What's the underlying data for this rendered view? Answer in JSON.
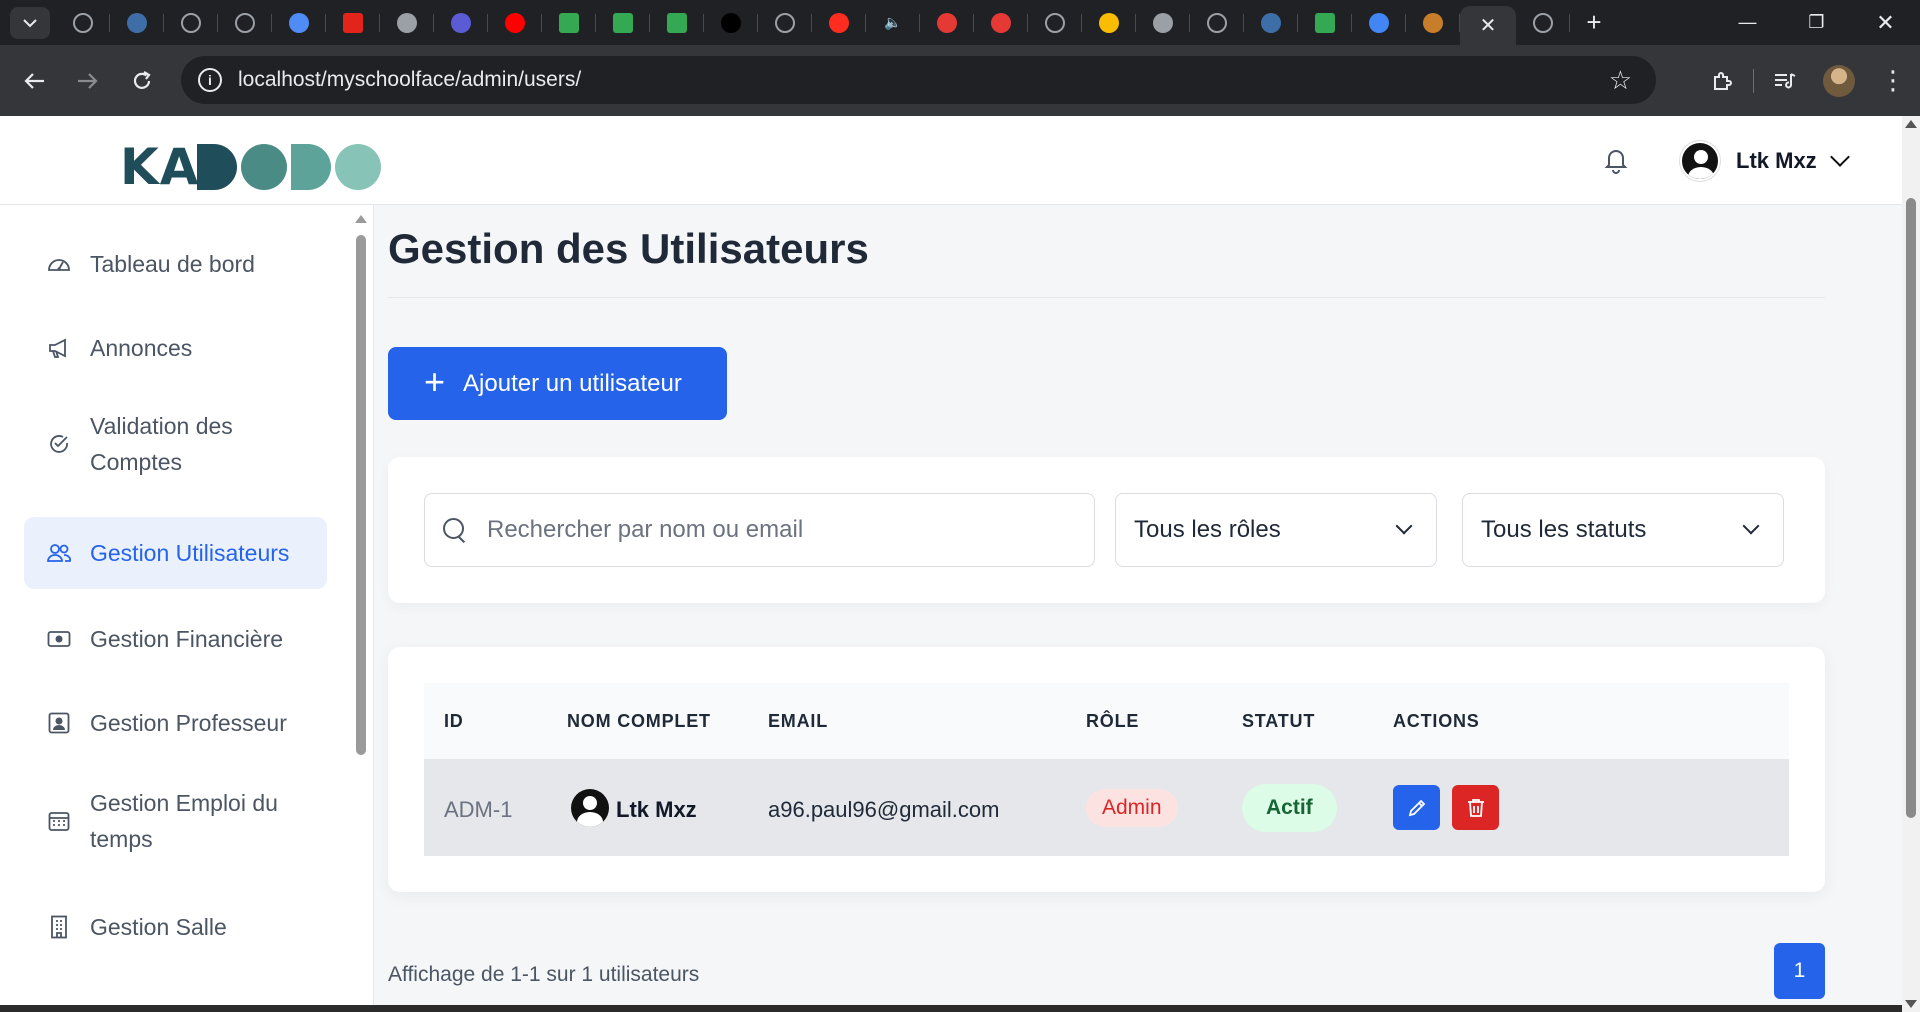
{
  "browser": {
    "url": "localhost/myschoolface/admin/users/",
    "tabs": [
      {
        "icon": "globe-icon",
        "color": "#5f6368"
      },
      {
        "icon": "image-icon",
        "color": "#3d6ea8"
      },
      {
        "icon": "globe-icon",
        "color": "#5f6368"
      },
      {
        "icon": "globe-icon",
        "color": "#5f6368"
      },
      {
        "icon": "gemini-icon",
        "color": "#4f8cf7"
      },
      {
        "icon": "adobe-icon",
        "color": "#e3241b"
      },
      {
        "icon": "chrome-icon",
        "color": "#9aa0a6"
      },
      {
        "icon": "app-icon",
        "color": "#5b5bd6"
      },
      {
        "icon": "youtube-icon",
        "color": "#ff0000"
      },
      {
        "icon": "drive-icon",
        "color": "#34a853"
      },
      {
        "icon": "drive-icon",
        "color": "#34a853"
      },
      {
        "icon": "drive-icon",
        "color": "#34a853"
      },
      {
        "icon": "tiktok-icon",
        "color": "#000000"
      },
      {
        "icon": "globe-icon",
        "color": "#5f6368"
      },
      {
        "icon": "laravel-icon",
        "color": "#ff2d20"
      },
      {
        "icon": "speaker-icon",
        "color": "#e8eaed"
      },
      {
        "icon": "runner-icon",
        "color": "#e53935"
      },
      {
        "icon": "runner-icon",
        "color": "#e53935"
      },
      {
        "icon": "globe-icon",
        "color": "#5f6368"
      },
      {
        "icon": "pinwheel-icon",
        "color": "#fbbc04"
      },
      {
        "icon": "chrome-icon",
        "color": "#9aa0a6"
      },
      {
        "icon": "globe-icon",
        "color": "#5f6368"
      },
      {
        "icon": "image-icon",
        "color": "#3d6ea8"
      },
      {
        "icon": "drive-icon",
        "color": "#34a853"
      },
      {
        "icon": "google-icon",
        "color": "#4285f4"
      },
      {
        "icon": "maiden-icon",
        "color": "#c77d2a"
      }
    ],
    "active_tab_close": "✕",
    "after_tabs": [
      {
        "icon": "globe-icon",
        "color": "#5f6368"
      }
    ],
    "new_tab": "+",
    "window": {
      "minimize": "—",
      "restore": "❐",
      "close": "✕"
    }
  },
  "header": {
    "logo": {
      "text": "KA",
      "dots": [
        "#1f4e5a",
        "#4a8b86",
        "#5da39a",
        "#87c4b7"
      ]
    },
    "user_name": "Ltk Mxz"
  },
  "sidebar": {
    "items": [
      {
        "label": "Tableau de bord",
        "icon": "dashboard-icon",
        "active": false
      },
      {
        "label": "Annonces",
        "icon": "megaphone-icon",
        "active": false
      },
      {
        "label": "Validation des Comptes",
        "icon": "check-circle-icon",
        "active": false
      },
      {
        "label": "Gestion Utilisateurs",
        "icon": "users-icon",
        "active": true
      },
      {
        "label": "Gestion Financière",
        "icon": "money-icon",
        "active": false
      },
      {
        "label": "Gestion Professeur",
        "icon": "id-card-icon",
        "active": false
      },
      {
        "label": "Gestion Emploi du temps",
        "icon": "calendar-icon",
        "active": false
      },
      {
        "label": "Gestion Salle",
        "icon": "building-icon",
        "active": false
      }
    ]
  },
  "main": {
    "title": "Gestion des Utilisateurs",
    "add_button": "Ajouter un utilisateur",
    "search_placeholder": "Rechercher par nom ou email",
    "role_filter": "Tous les rôles",
    "status_filter": "Tous les statuts",
    "table": {
      "columns": [
        "ID",
        "NOM COMPLET",
        "EMAIL",
        "RÔLE",
        "STATUT",
        "ACTIONS"
      ],
      "rows": [
        {
          "id": "ADM-1",
          "name": "Ltk Mxz",
          "email": "a96.paul96@gmail.com",
          "role": "Admin",
          "status": "Actif"
        }
      ]
    },
    "pagination_info": "Affichage de 1-1 sur 1 utilisateurs",
    "current_page": "1"
  },
  "colors": {
    "primary": "#2563eb",
    "danger": "#dc2626",
    "success_bg": "#dcfce7",
    "active_bg": "#eaf1fd"
  }
}
